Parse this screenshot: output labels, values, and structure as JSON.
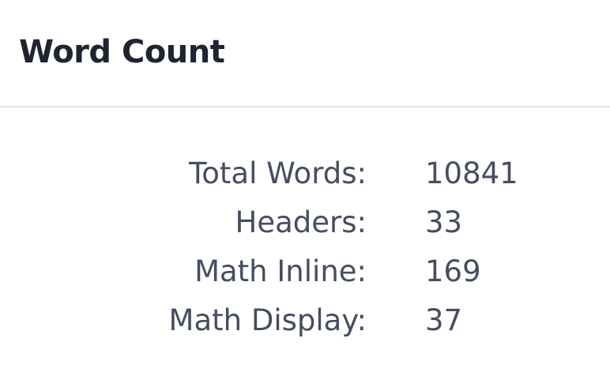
{
  "dialog": {
    "title": "Word Count"
  },
  "stats": [
    {
      "label": "Total Words:",
      "value": "10841"
    },
    {
      "label": "Headers:",
      "value": "33"
    },
    {
      "label": "Math Inline:",
      "value": "169"
    },
    {
      "label": "Math Display:",
      "value": "37"
    }
  ]
}
